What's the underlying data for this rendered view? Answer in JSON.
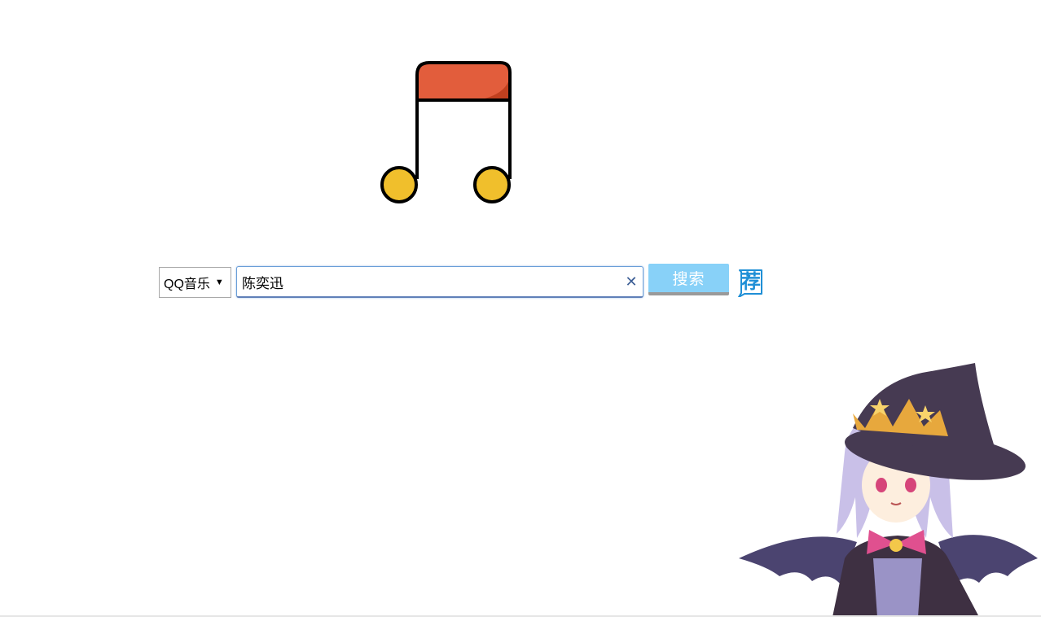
{
  "logo": {
    "icon": "music-note-icon",
    "colors": {
      "flag": "#e25d3c",
      "flag_shade": "#c0401f",
      "heads": "#f0bf2c",
      "outline": "#000000"
    }
  },
  "search": {
    "source_selected": "QQ音乐",
    "source_arrow": "▼",
    "query_value": "陈奕迅",
    "clear_symbol": "✕",
    "button_label": "搜索",
    "recommend_label": "荐"
  },
  "mascot": {
    "icon": "witch-girl-mascot"
  },
  "colors": {
    "accent": "#88d1f8",
    "input_border": "#6a9ed8",
    "recommend": "#1f8fd6"
  }
}
